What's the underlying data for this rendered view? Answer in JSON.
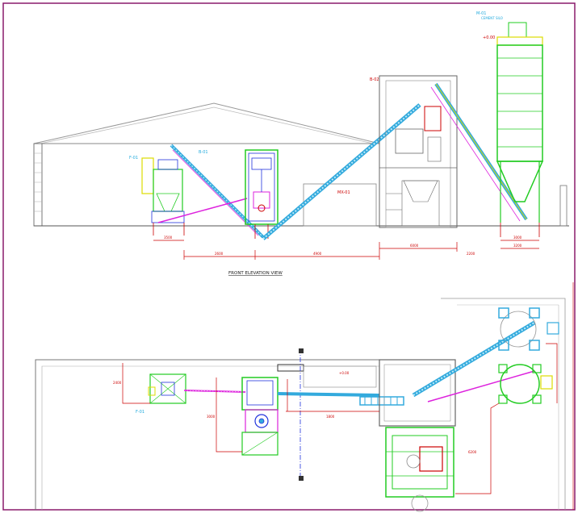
{
  "drawing": {
    "elevation_title": "FRONT ELEVATION VIEW",
    "labels": {
      "silo_tag": "M-01",
      "silo_sub": "CEMENT SILO",
      "bag_tag": "F-01",
      "bag_plan_tag": "F-01",
      "bucket_tag": "B-01",
      "mixer_tag": "MX-01",
      "building_tag": "B-02",
      "level_mark": "+0.00"
    },
    "dims_elev": [
      "3500",
      "2600",
      "4900",
      "6000",
      "3000",
      "3200",
      "2200"
    ],
    "dims_plan": [
      "2400",
      "3000",
      "1800",
      "6200"
    ],
    "colors": {
      "frame": "#8a1a6b",
      "conveyor": "#33aadd",
      "green": "#22cc22",
      "dim": "#cc0000",
      "outline": "#777777",
      "yellow": "#dddd00",
      "magenta": "#dd22dd",
      "blue": "#2233dd"
    }
  }
}
